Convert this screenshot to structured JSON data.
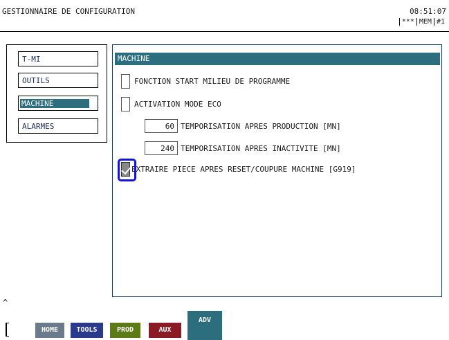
{
  "header": {
    "title": "GESTIONNAIRE DE CONFIGURATION",
    "clock": "08:51:07",
    "status": [
      "***",
      "MEM",
      "#1"
    ]
  },
  "nav": {
    "items": [
      {
        "label": "T-MI"
      },
      {
        "label": "OUTILS"
      },
      {
        "label": "MACHINE"
      },
      {
        "label": "ALARMES"
      }
    ],
    "active": "MACHINE"
  },
  "main": {
    "section_title": "MACHINE",
    "options": [
      {
        "label": "FONCTION START MILIEU DE PROGRAMME",
        "checked": false
      },
      {
        "label": "ACTIVATION MODE ECO",
        "checked": false
      },
      {
        "label": "EXTRAIRE PIECE APRES RESET/COUPURE MACHINE [G919]",
        "checked": true
      }
    ],
    "fields": [
      {
        "value": "60",
        "label": "TEMPORISATION APRES PRODUCTION [MN]"
      },
      {
        "value": "240",
        "label": "TEMPORISATION APRES INACTIVITE [MN]"
      }
    ]
  },
  "footer": {
    "scroll_up": "^",
    "tabs": [
      {
        "label": "HOME",
        "color": "#6b7b8c"
      },
      {
        "label": "TOOLS",
        "color": "#2a3a8c"
      },
      {
        "label": "PROD",
        "color": "#5c7a16"
      },
      {
        "label": "AUX",
        "color": "#8c1a24"
      },
      {
        "label": "ADV",
        "color": "#2d6e7e"
      }
    ]
  },
  "colors": {
    "accent": "#2d6e7e",
    "focus": "#1414d6"
  }
}
